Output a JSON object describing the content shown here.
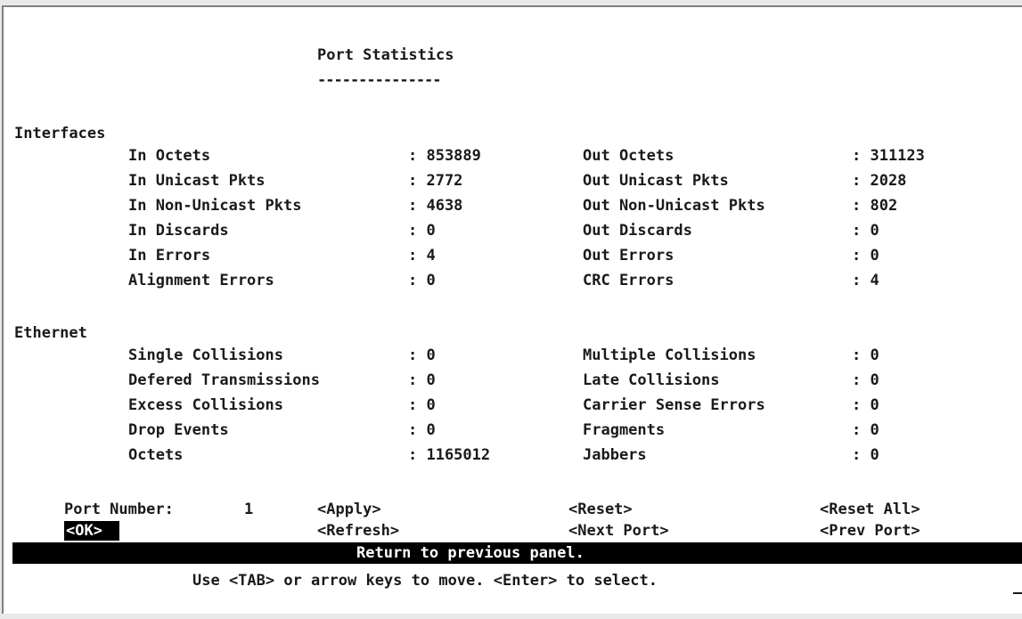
{
  "title": "Port Statistics",
  "title_underline": "---------------",
  "interfaces": {
    "section": "Interfaces",
    "rows": [
      {
        "l_label": "In Octets",
        "l_value": ": 853889",
        "r_label": "Out Octets",
        "r_value": ": 311123"
      },
      {
        "l_label": "In Unicast Pkts",
        "l_value": ": 2772",
        "r_label": "Out Unicast Pkts",
        "r_value": ": 2028"
      },
      {
        "l_label": "In Non-Unicast Pkts",
        "l_value": ": 4638",
        "r_label": "Out Non-Unicast Pkts",
        "r_value": ": 802"
      },
      {
        "l_label": "In Discards",
        "l_value": ": 0",
        "r_label": "Out Discards",
        "r_value": ": 0"
      },
      {
        "l_label": "In Errors",
        "l_value": ": 4",
        "r_label": "Out Errors",
        "r_value": ": 0"
      },
      {
        "l_label": "Alignment Errors",
        "l_value": ": 0",
        "r_label": "CRC Errors",
        "r_value": ": 4"
      }
    ]
  },
  "ethernet": {
    "section": "Ethernet",
    "rows": [
      {
        "l_label": "Single Collisions",
        "l_value": ": 0",
        "r_label": "Multiple Collisions",
        "r_value": ": 0"
      },
      {
        "l_label": "Defered Transmissions",
        "l_value": ": 0",
        "r_label": "Late Collisions",
        "r_value": ": 0"
      },
      {
        "l_label": "Excess Collisions",
        "l_value": ": 0",
        "r_label": "Carrier Sense Errors",
        "r_value": ": 0"
      },
      {
        "l_label": "Drop Events",
        "l_value": ": 0",
        "r_label": "Fragments",
        "r_value": ": 0"
      },
      {
        "l_label": "Octets",
        "l_value": ": 1165012",
        "r_label": "Jabbers",
        "r_value": ": 0"
      }
    ]
  },
  "port": {
    "label": "Port Number:",
    "value": "1"
  },
  "buttons": {
    "apply": "<Apply>",
    "reset": "<Reset>",
    "reset_all": "<Reset All>",
    "ok": "<OK>",
    "refresh": "<Refresh>",
    "next_port": "<Next Port>",
    "prev_port": "<Prev Port>"
  },
  "status": "Return to previous panel.",
  "help": "Use <TAB> or arrow keys to move. <Enter> to select."
}
